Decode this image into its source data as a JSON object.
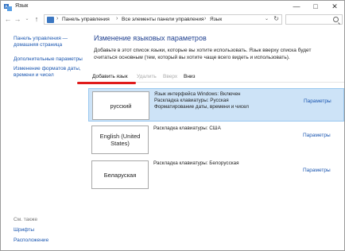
{
  "window": {
    "title": "Язык",
    "min": "—",
    "max": "□",
    "close": "✕"
  },
  "nav": {
    "back": "←",
    "forward": "→",
    "dropdown": "⌄",
    "up": "↑"
  },
  "breadcrumbs": [
    "Панель управления",
    "Все элементы панели управления",
    "Язык"
  ],
  "breadcrumb_separator": "›",
  "search": {
    "placeholder": ""
  },
  "sidebar": {
    "links": [
      "Панель управления — домашняя страница",
      "Дополнительные параметры",
      "Изменение форматов даты, времени и чисел"
    ],
    "see_also_title": "См. также",
    "see_also": [
      "Шрифты",
      "Расположение"
    ]
  },
  "main": {
    "title": "Изменение языковых параметров",
    "description": "Добавьте в этот список языки, которые вы хотите использовать. Язык вверху списка будет считаться основным (тем, который вы хотите чаще всего видеть и использовать)."
  },
  "toolbar": {
    "add": "Добавить язык",
    "remove": "Удалить",
    "up": "Вверх",
    "down": "Вниз"
  },
  "languages": [
    {
      "name": "русский",
      "info": [
        "Язык интерфейса Windows: Включен",
        "Раскладка клавиатуры: Русская",
        "Форматирование даты, времени и чисел"
      ],
      "params": "Параметры",
      "selected": true
    },
    {
      "name": "English (United States)",
      "info": [
        "Раскладка клавиатуры: США"
      ],
      "params": "Параметры",
      "selected": false
    },
    {
      "name": "Беларуская",
      "info": [
        "Раскладка клавиатуры: Белорусская"
      ],
      "params": "Параметры",
      "selected": false
    }
  ],
  "colors": {
    "accent_link": "#1a56b0",
    "selected_row": "#cde3f7",
    "annotation_red": "#e01b1b"
  }
}
